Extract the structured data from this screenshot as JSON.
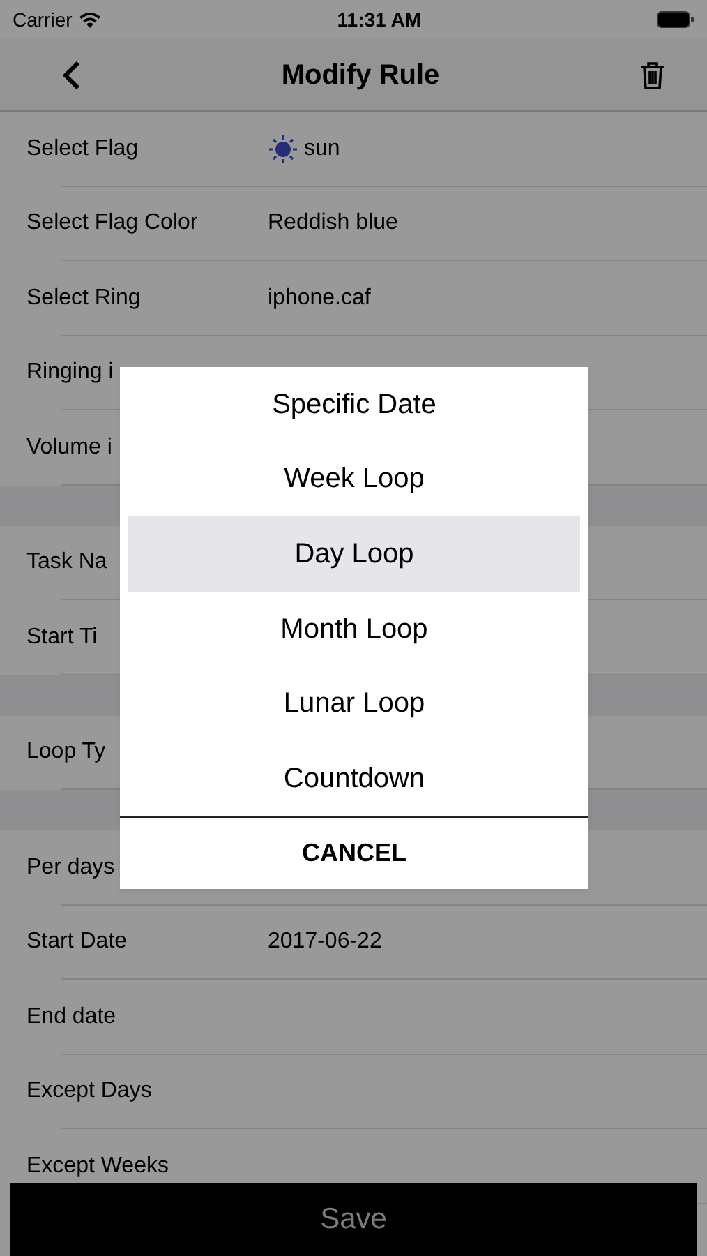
{
  "status_bar": {
    "carrier": "Carrier",
    "time": "11:31 AM"
  },
  "nav": {
    "title": "Modify Rule"
  },
  "sections": [
    {
      "rows": [
        {
          "label": "Select Flag",
          "value": "sun",
          "kind": "flag"
        },
        {
          "label": "Select Flag Color",
          "value": "Reddish blue",
          "kind": "text"
        },
        {
          "label": "Select Ring",
          "value": "iphone.caf",
          "kind": "text"
        },
        {
          "label": "Ringing i",
          "kind": "text"
        },
        {
          "label": "Volume i",
          "kind": "text"
        }
      ]
    },
    {
      "rows": [
        {
          "label": "Task Na",
          "kind": "text"
        },
        {
          "label": "Start Ti",
          "kind": "text"
        }
      ]
    },
    {
      "rows": [
        {
          "label": "Loop Ty",
          "kind": "text"
        }
      ]
    },
    {
      "rows": [
        {
          "label": "Per days",
          "kind": "text"
        },
        {
          "label": "Start Date",
          "value": "2017-06-22",
          "kind": "text"
        },
        {
          "label": "End date",
          "kind": "text"
        },
        {
          "label": "Except Days",
          "kind": "text"
        },
        {
          "label": "Except Weeks",
          "kind": "text"
        }
      ]
    }
  ],
  "save_button": "Save",
  "menu": {
    "options": [
      {
        "label": "Specific Date",
        "selected": false
      },
      {
        "label": "Week Loop",
        "selected": false
      },
      {
        "label": "Day Loop",
        "selected": true
      },
      {
        "label": "Month Loop",
        "selected": false
      },
      {
        "label": "Lunar Loop",
        "selected": false
      },
      {
        "label": "Countdown",
        "selected": false
      }
    ],
    "cancel": "CANCEL"
  }
}
